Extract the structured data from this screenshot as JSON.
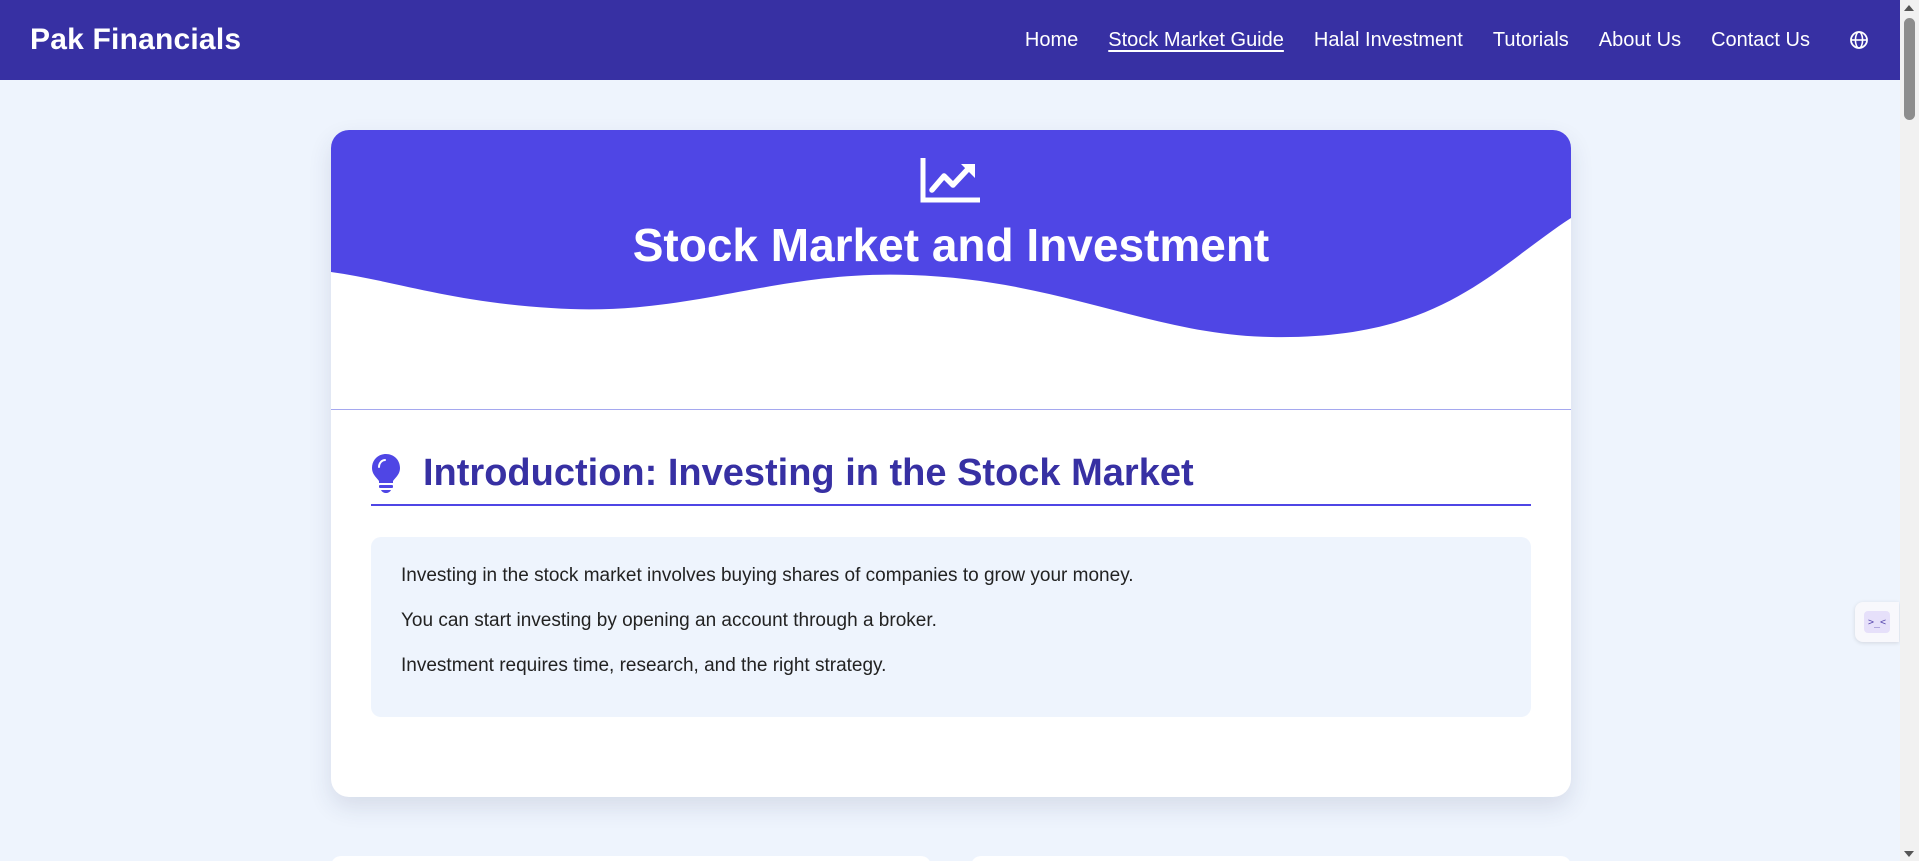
{
  "header": {
    "brand": "Pak Financials",
    "nav": [
      {
        "label": "Home",
        "active": false
      },
      {
        "label": "Stock Market Guide",
        "active": true
      },
      {
        "label": "Halal Investment",
        "active": false
      },
      {
        "label": "Tutorials",
        "active": false
      },
      {
        "label": "About Us",
        "active": false
      },
      {
        "label": "Contact Us",
        "active": false
      }
    ],
    "language_icon": "globe-icon"
  },
  "hero": {
    "icon": "chart-line-icon",
    "title": "Stock Market and Investment"
  },
  "intro": {
    "icon": "lightbulb-icon",
    "title": "Introduction: Investing in the Stock Market",
    "paragraphs": [
      "Investing in the stock market involves buying shares of companies to grow your money.",
      "You can start investing by opening an account through a broker.",
      "Investment requires time, research, and the right strategy."
    ]
  },
  "widget": {
    "icon": "terminal-face-icon",
    "glyph": ">_<"
  },
  "colors": {
    "navbar": "#3730a3",
    "hero": "#4f46e5",
    "heading": "#3730a3",
    "page_bg": "#eef4fd",
    "info_bg": "#eef4fd"
  }
}
